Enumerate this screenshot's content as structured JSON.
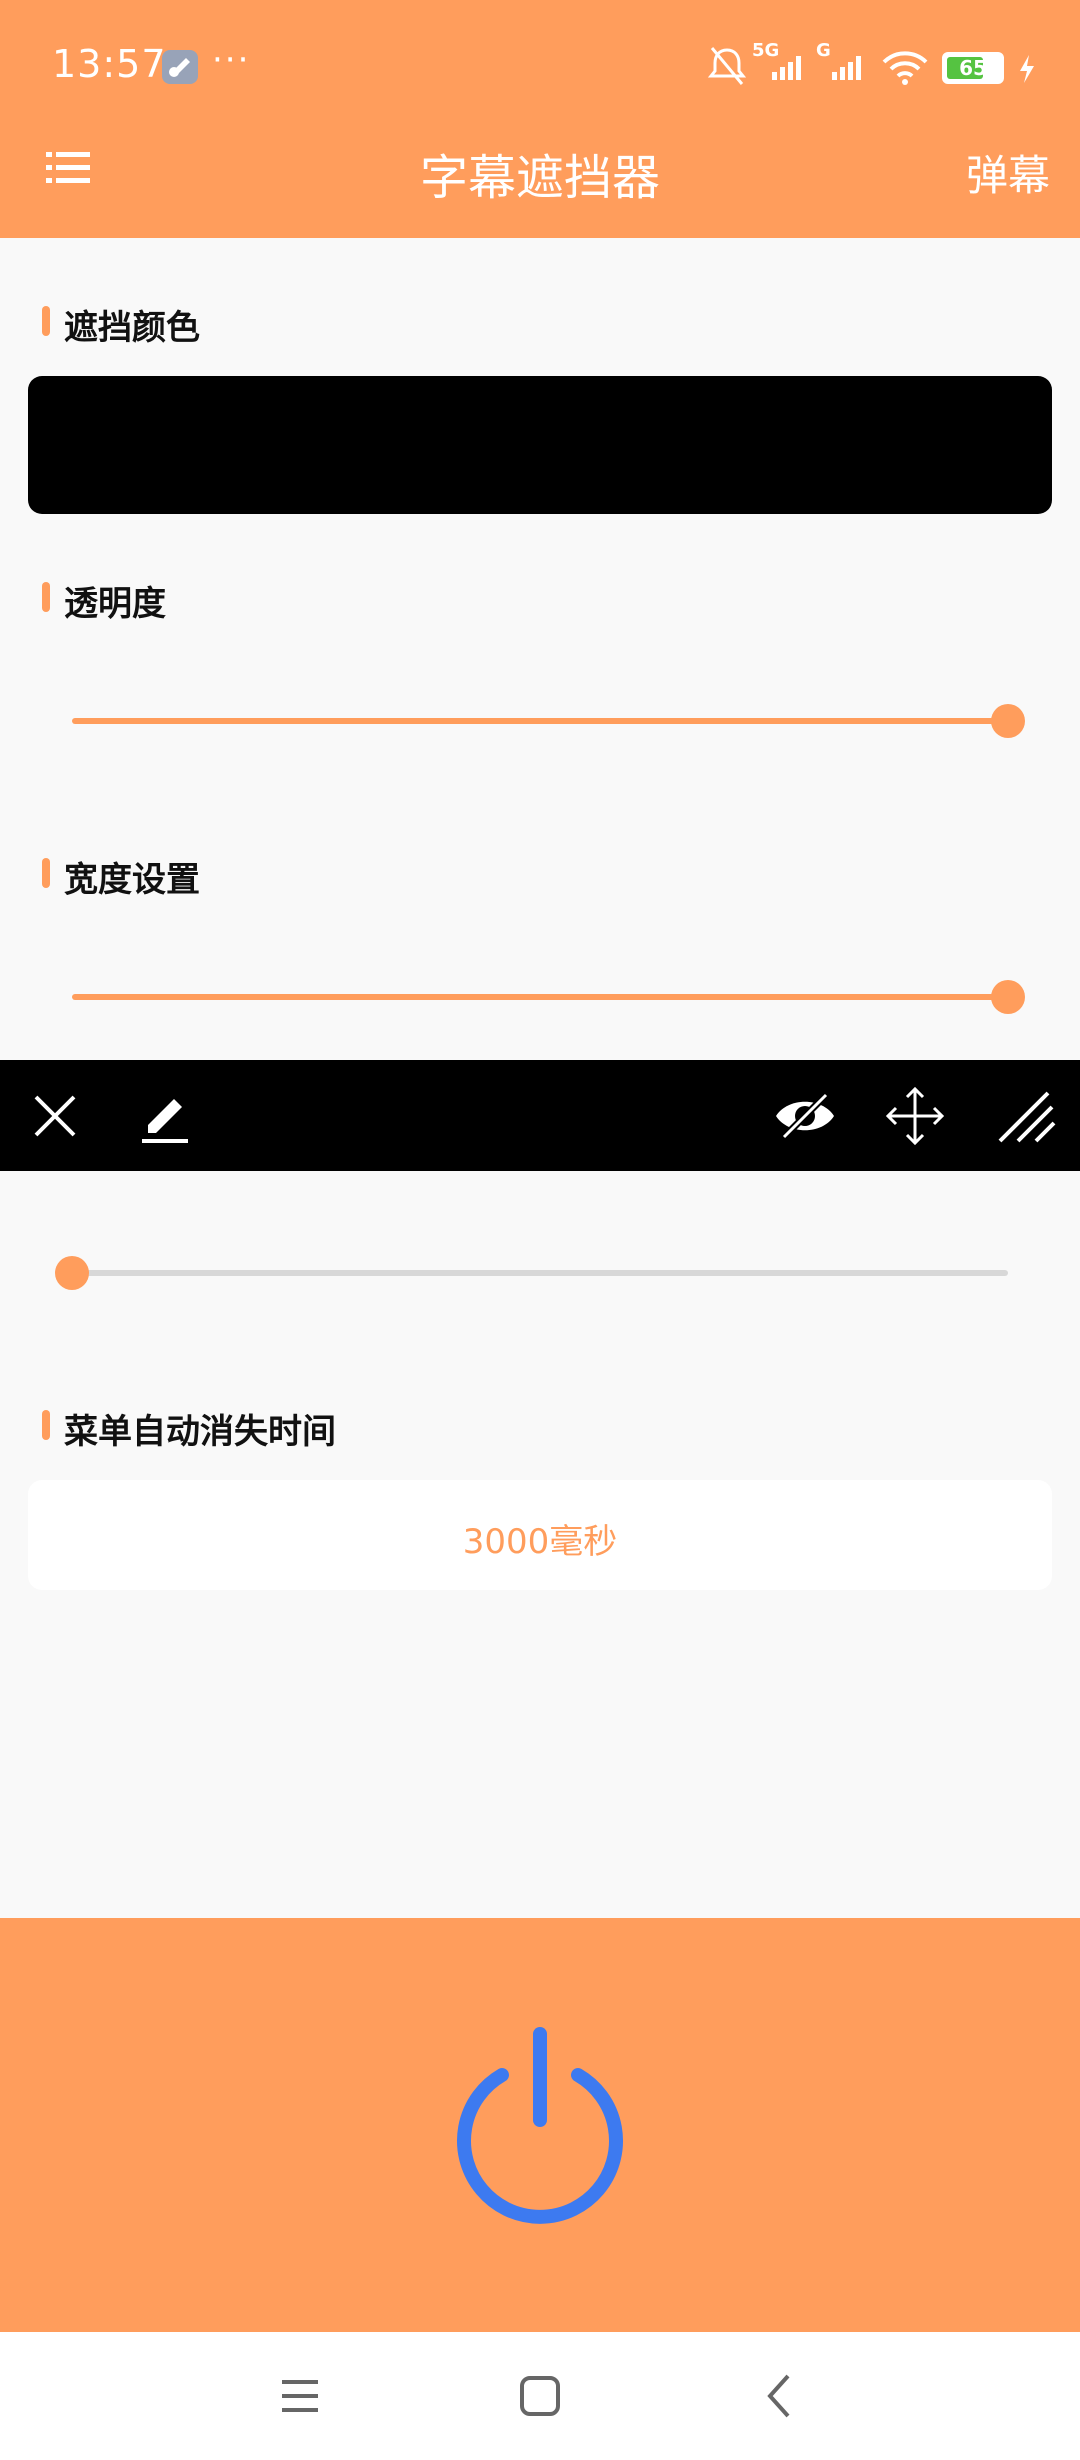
{
  "status_bar": {
    "time": "13:57",
    "more": "···",
    "network_1": "5G",
    "network_2": "G",
    "battery_level": "65"
  },
  "app_bar": {
    "title": "字幕遮挡器",
    "right_action": "弹幕"
  },
  "sections": {
    "mask_color_title": "遮挡颜色",
    "opacity_title": "透明度",
    "width_title": "宽度设置",
    "menu_timeout_title": "菜单自动消失时间"
  },
  "values": {
    "mask_color": "#000000",
    "opacity_fraction": 1.0,
    "width_fraction": 1.0,
    "third_slider_fraction": 0.0,
    "menu_timeout": "3000毫秒"
  },
  "colors": {
    "accent": "#FF9D5C",
    "power_icon": "#3D7AF0",
    "track_inactive": "#D8D8D8"
  },
  "icons": {
    "menu": "menu-icon",
    "close": "close-icon",
    "edit": "edit-icon",
    "hide": "eye-slash-icon",
    "move": "move-arrows-icon",
    "resize": "resize-icon",
    "power": "power-icon"
  }
}
